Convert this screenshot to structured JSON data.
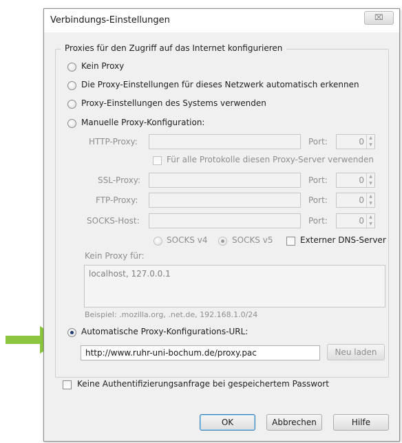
{
  "dialog": {
    "title": "Verbindungs-Einstellungen",
    "close_glyph": "⌧"
  },
  "proxy_group": {
    "legend": "Proxies für den Zugriff auf das Internet konfigurieren",
    "options": [
      {
        "label": "Kein Proxy",
        "checked": false
      },
      {
        "label": "Die Proxy-Einstellungen für dieses Netzwerk automatisch erkennen",
        "checked": false
      },
      {
        "label": "Proxy-Einstellungen des Systems verwenden",
        "checked": false
      },
      {
        "label": "Manuelle Proxy-Konfiguration:",
        "checked": false
      }
    ],
    "manual": {
      "http_label": "HTTP-Proxy:",
      "ssl_label": "SSL-Proxy:",
      "ftp_label": "FTP-Proxy:",
      "socks_label": "SOCKS-Host:",
      "port_label": "Port:",
      "port_value": "0",
      "all_protocols_label": "Für alle Protokolle diesen Proxy-Server verwenden",
      "socks_v4_label": "SOCKS v4",
      "socks_v5_label": "SOCKS v5",
      "socks_v5_checked": true,
      "remote_dns_label": "Externer DNS-Server"
    },
    "no_proxy": {
      "label": "Kein Proxy für:",
      "value": "localhost, 127.0.0.1",
      "example": "Beispiel: .mozilla.org, .net.de, 192.168.1.0/24"
    },
    "auto_url": {
      "label": "Automatische Proxy-Konfigurations-URL:",
      "checked": true,
      "value": "http://www.ruhr-uni-bochum.de/proxy.pac",
      "reload_label": "Neu laden"
    }
  },
  "no_auth_prompt_label": "Keine Authentifizierungsanfrage bei gespeichertem Passwort",
  "buttons": {
    "ok": "OK",
    "cancel": "Abbrechen",
    "help": "Hilfe"
  },
  "colors": {
    "arrow": "#8cc63f"
  },
  "icons": {
    "arrow": "arrow-right-icon",
    "close": "close-icon"
  }
}
